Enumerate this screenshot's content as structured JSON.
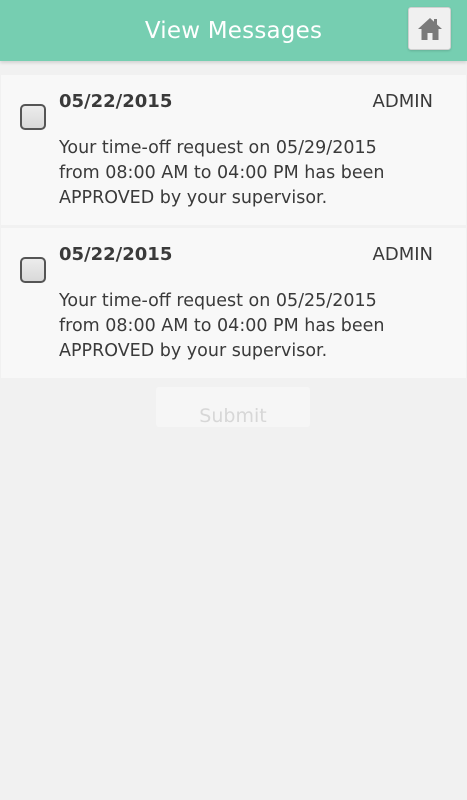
{
  "header": {
    "title": "View Messages",
    "home_icon": "home-icon",
    "background_color": "#76ceb1"
  },
  "messages": [
    {
      "date": "05/22/2015",
      "sender": "ADMIN",
      "body": "Your time-off request on 05/29/2015 from 08:00 AM to 04:00 PM has been APPROVED by your supervisor.",
      "checked": false
    },
    {
      "date": "05/22/2015",
      "sender": "ADMIN",
      "body": "Your time-off request on 05/25/2015 from 08:00 AM to 04:00 PM has been APPROVED by your supervisor.",
      "checked": false
    }
  ],
  "submit": {
    "label": "Submit"
  }
}
